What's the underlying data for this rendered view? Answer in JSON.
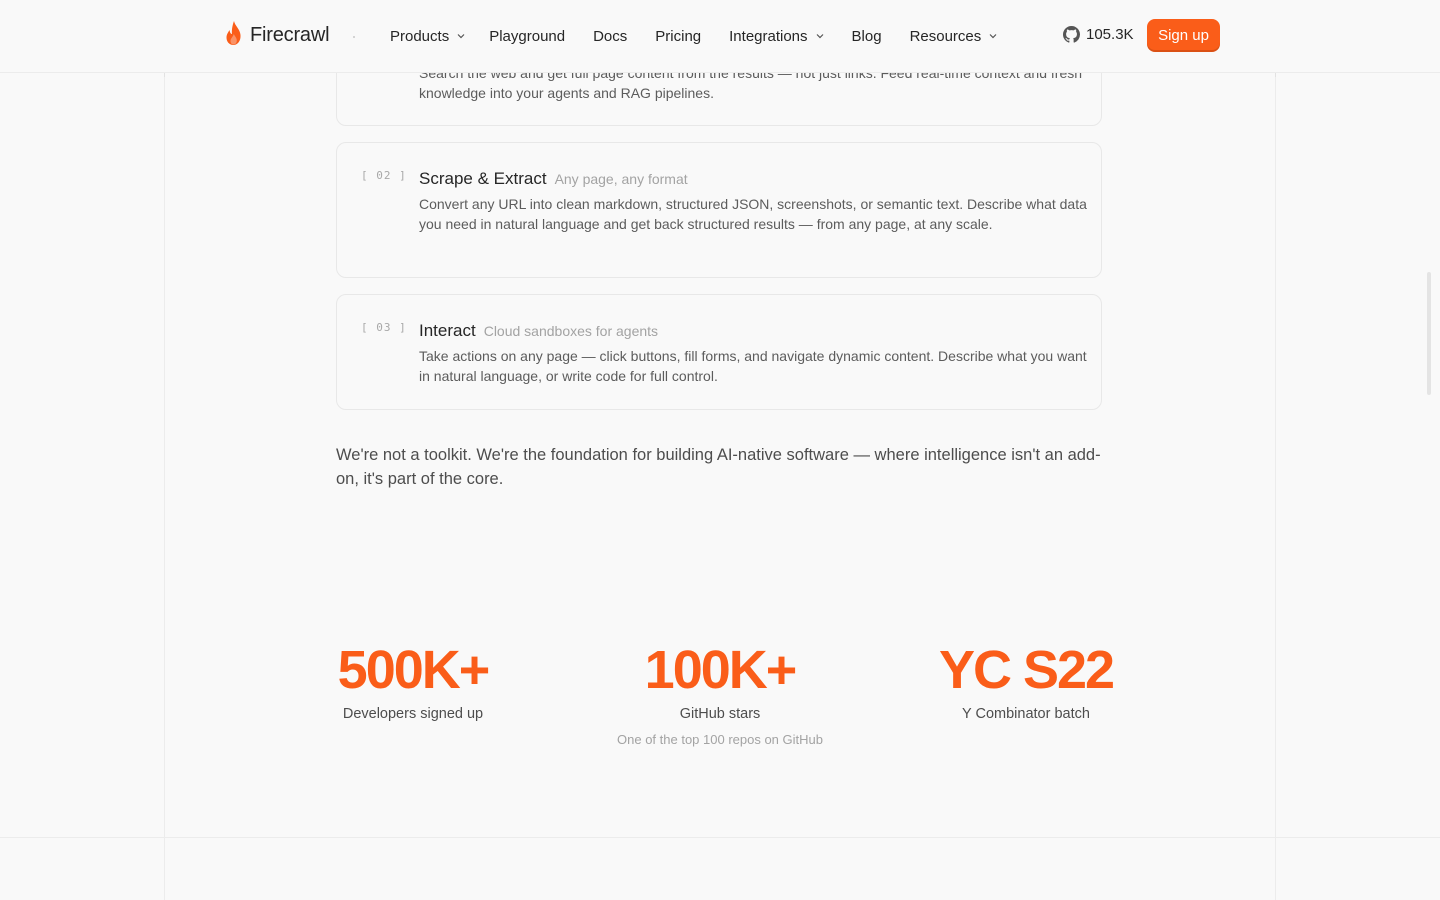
{
  "header": {
    "logo_text": "Firecrawl",
    "nav": [
      {
        "label": "Products",
        "dropdown": true
      },
      {
        "label": "Playground",
        "dropdown": false
      },
      {
        "label": "Docs",
        "dropdown": false
      },
      {
        "label": "Pricing",
        "dropdown": false
      },
      {
        "label": "Integrations",
        "dropdown": true
      },
      {
        "label": "Blog",
        "dropdown": false
      },
      {
        "label": "Resources",
        "dropdown": true
      }
    ],
    "github_stars": "105.3K",
    "signup_label": "Sign up"
  },
  "cards": [
    {
      "num": "",
      "title": "",
      "subtitle": "",
      "desc": "Search the web and get full page content from the results — not just links. Feed real-time context and fresh knowledge into your agents and RAG pipelines."
    },
    {
      "num": "[ 02 ]",
      "title": "Scrape & Extract",
      "subtitle": "Any page, any format",
      "desc": "Convert any URL into clean markdown, structured JSON, screenshots, or semantic text. Describe what data you need in natural language and get back structured results — from any page, at any scale."
    },
    {
      "num": "[ 03 ]",
      "title": "Interact",
      "subtitle": "Cloud sandboxes for agents",
      "desc": "Take actions on any page — click buttons, fill forms, and navigate dynamic content. Describe what you want in natural language, or write code for full control."
    }
  ],
  "foundation_text": "We're not a toolkit. We're the foundation for building AI-native software — where intelligence isn't an add-on, it's part of the core.",
  "stats": [
    {
      "value": "500K+",
      "label": "Developers signed up",
      "sub": ""
    },
    {
      "value": "100K+",
      "label": "GitHub stars",
      "sub": "One of the top 100 repos on GitHub"
    },
    {
      "value": "YC S22",
      "label": "Y Combinator batch",
      "sub": ""
    }
  ],
  "colors": {
    "accent": "#fa5d19",
    "background": "#f9f9f9"
  },
  "icons": {
    "logo": "flame-icon",
    "github": "github-icon",
    "dropdown": "chevron-down-icon"
  }
}
